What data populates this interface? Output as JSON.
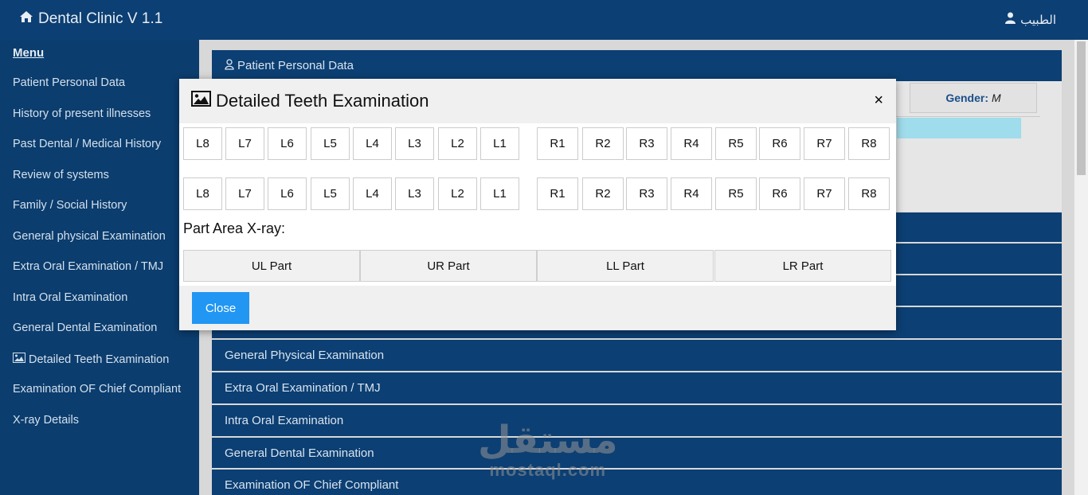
{
  "app": {
    "brand": "Dental Clinic V 1.1",
    "brand_icon": "home-icon",
    "user_label": "الطبيب",
    "user_icon": "user-icon"
  },
  "sidebar": {
    "menu_title": "Menu",
    "items": [
      {
        "label": "Patient Personal Data"
      },
      {
        "label": "History of present illnesses"
      },
      {
        "label": "Past Dental / Medical History"
      },
      {
        "label": "Review of systems"
      },
      {
        "label": "Family / Social History"
      },
      {
        "label": "General physical Examination"
      },
      {
        "label": "Extra Oral Examination / TMJ"
      },
      {
        "label": "Intra Oral Examination"
      },
      {
        "label": "General Dental Examination"
      },
      {
        "label": "Detailed Teeth Examination",
        "icon": "image-icon"
      },
      {
        "label": "Examination OF Chief Compliant"
      },
      {
        "label": "X-ray Details"
      }
    ]
  },
  "main": {
    "patient_panel_title": "Patient Personal Data",
    "gender_label": "Gender:",
    "gender_value": "M",
    "sections": [
      {
        "label": "General Physical Examination"
      },
      {
        "label": "Extra Oral Examination / TMJ"
      },
      {
        "label": "Intra Oral Examination"
      },
      {
        "label": "General Dental Examination"
      },
      {
        "label": "Examination OF Chief Compliant"
      }
    ]
  },
  "modal": {
    "title": "Detailed Teeth Examination",
    "title_icon": "image-icon",
    "close_symbol": "×",
    "left_teeth": [
      "L8",
      "L7",
      "L6",
      "L5",
      "L4",
      "L3",
      "L2",
      "L1"
    ],
    "right_teeth": [
      "R1",
      "R2",
      "R3",
      "R4",
      "R5",
      "R6",
      "R7",
      "R8"
    ],
    "part_area_label": "Part Area X-ray:",
    "parts": [
      "UL Part",
      "UR Part",
      "LL Part",
      "LR Part"
    ],
    "close_button": "Close"
  },
  "watermark": {
    "arabic": "مستقل",
    "latin": "mostaql.com"
  }
}
